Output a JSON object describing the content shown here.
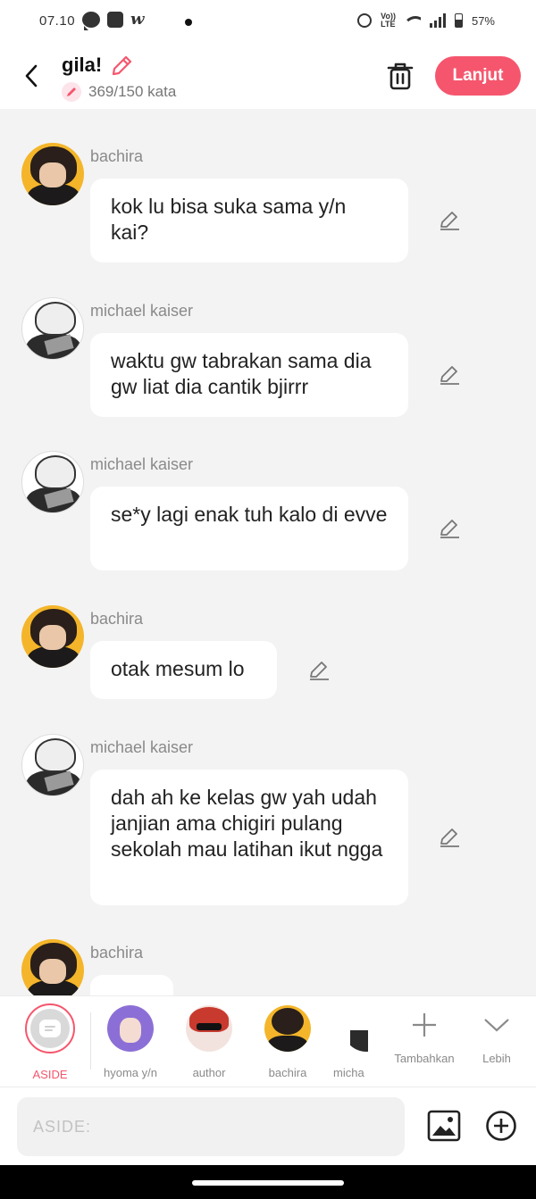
{
  "status_bar": {
    "time": "07.10",
    "battery": "57%",
    "network": "LTE",
    "volte": "Vo))"
  },
  "header": {
    "title": "gila!",
    "word_count": "369/150 kata",
    "next_label": "Lanjut"
  },
  "messages": [
    {
      "sender": "bachira",
      "text": "kok lu bisa suka sama y/n kai?"
    },
    {
      "sender": "michael kaiser",
      "text": "waktu gw tabrakan sama dia gw liat dia cantik bjirrr"
    },
    {
      "sender": "michael kaiser",
      "text": "se*y lagi enak tuh kalo di evve"
    },
    {
      "sender": "bachira",
      "text": "otak mesum lo"
    },
    {
      "sender": "michael kaiser",
      "text": "dah ah ke kelas gw yah udah janjian ama chigiri pulang sekolah mau latihan ikut ngga"
    },
    {
      "sender": "bachira",
      "text": ""
    }
  ],
  "characters": [
    {
      "label": "ASIDE"
    },
    {
      "label": "hyoma y/n"
    },
    {
      "label": "author"
    },
    {
      "label": "bachira"
    },
    {
      "label": "micha"
    }
  ],
  "actions": {
    "add_label": "Tambahkan",
    "more_label": "Lebih"
  },
  "input": {
    "placeholder": "ASIDE:"
  },
  "colors": {
    "accent": "#f5566d",
    "background": "#f3f3f3",
    "bubble": "#ffffff"
  },
  "icons": [
    "back-arrow-icon",
    "pencil-icon",
    "trash-icon",
    "edit-icon",
    "plus-icon",
    "chevron-down-icon",
    "image-icon",
    "add-circle-icon"
  ]
}
